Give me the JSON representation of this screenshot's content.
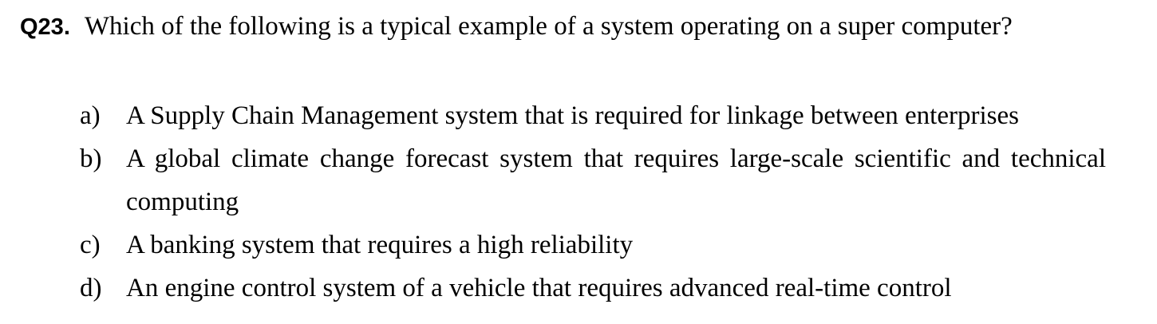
{
  "question": {
    "number": "Q23.",
    "text": "Which of the following is a typical example of a system operating on a super computer?"
  },
  "options": [
    {
      "letter": "a)",
      "text": "A Supply Chain Management system that is required for linkage between enterprises"
    },
    {
      "letter": "b)",
      "text": "A global climate change forecast system that requires large-scale scientific and technical computing"
    },
    {
      "letter": "c)",
      "text": "A banking system that requires a high reliability"
    },
    {
      "letter": "d)",
      "text": "An engine control system of a vehicle that requires advanced real-time control"
    }
  ]
}
